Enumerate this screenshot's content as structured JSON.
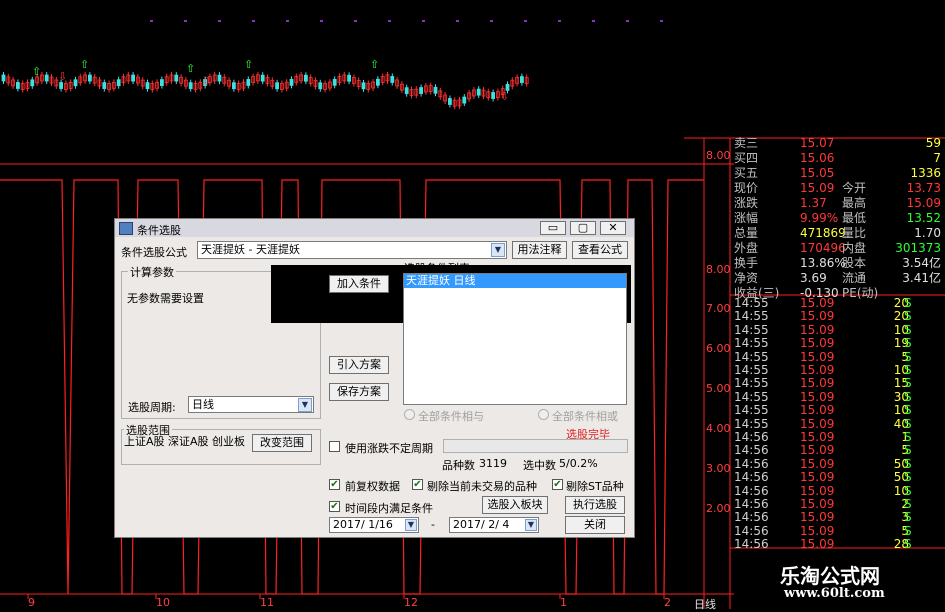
{
  "chart": {
    "price_labels": [
      "8.00",
      "8.00",
      "7.00",
      "6.00",
      "5.00",
      "4.00",
      "3.00",
      "2.00"
    ],
    "date_labels": [
      "9",
      "10",
      "11",
      "12",
      "1",
      "2"
    ],
    "period_label": "日线"
  },
  "colors": {
    "up": "#ff3030",
    "down": "#30ff30",
    "axis": "#ff2020",
    "dialog_bg": "#ece9e6",
    "selection": "#3399ff"
  },
  "quote_panel": {
    "rows": [
      {
        "label": "卖三",
        "value": "15.07",
        "extra": "",
        "value2": "59"
      },
      {
        "label": "买四",
        "value": "15.06",
        "extra": "",
        "value2": "7"
      },
      {
        "label": "买五",
        "value": "15.05",
        "extra": "",
        "value2": "1336"
      },
      {
        "label": "现价",
        "value": "15.09",
        "extra": "今开",
        "value2": "13.73"
      },
      {
        "label": "涨跌",
        "value": "1.37",
        "extra": "最高",
        "value2": "15.09"
      },
      {
        "label": "涨幅",
        "value": "9.99%",
        "extra": "最低",
        "value2": "13.52"
      },
      {
        "label": "总量",
        "value": "471869",
        "extra": "量比",
        "value2": "1.70"
      },
      {
        "label": "外盘",
        "value": "170496",
        "extra": "内盘",
        "value2": "301373"
      },
      {
        "label": "换手",
        "value": "13.86%",
        "extra": "股本",
        "value2": "3.54亿"
      },
      {
        "label": "净资",
        "value": "3.69",
        "extra": "流通",
        "value2": "3.41亿"
      },
      {
        "label": "收益(三)",
        "value": "-0.130",
        "extra": "PE(动)",
        "value2": ""
      }
    ],
    "ticks": [
      {
        "time": "14:55",
        "price": "15.09",
        "vol": "20",
        "side": "S"
      },
      {
        "time": "14:55",
        "price": "15.09",
        "vol": "20",
        "side": "S"
      },
      {
        "time": "14:55",
        "price": "15.09",
        "vol": "10",
        "side": "S"
      },
      {
        "time": "14:55",
        "price": "15.09",
        "vol": "19",
        "side": "S"
      },
      {
        "time": "14:55",
        "price": "15.09",
        "vol": "5",
        "side": "S"
      },
      {
        "time": "14:55",
        "price": "15.09",
        "vol": "10",
        "side": "S"
      },
      {
        "time": "14:55",
        "price": "15.09",
        "vol": "15",
        "side": "S"
      },
      {
        "time": "14:55",
        "price": "15.09",
        "vol": "30",
        "side": "S"
      },
      {
        "time": "14:55",
        "price": "15.09",
        "vol": "10",
        "side": "S"
      },
      {
        "time": "14:55",
        "price": "15.09",
        "vol": "40",
        "side": "S"
      },
      {
        "time": "14:56",
        "price": "15.09",
        "vol": "1",
        "side": "S"
      },
      {
        "time": "14:56",
        "price": "15.09",
        "vol": "5",
        "side": "S"
      },
      {
        "time": "14:56",
        "price": "15.09",
        "vol": "50",
        "side": "S"
      },
      {
        "time": "14:56",
        "price": "15.09",
        "vol": "50",
        "side": "S"
      },
      {
        "time": "14:56",
        "price": "15.09",
        "vol": "10",
        "side": "S"
      },
      {
        "time": "14:56",
        "price": "15.09",
        "vol": "2",
        "side": "S"
      },
      {
        "time": "14:56",
        "price": "15.09",
        "vol": "3",
        "side": "S"
      },
      {
        "time": "14:56",
        "price": "15.09",
        "vol": "5",
        "side": "S"
      },
      {
        "time": "14:56",
        "price": "15.09",
        "vol": "28",
        "side": "S"
      }
    ]
  },
  "dialog": {
    "title": "条件选股",
    "formula_label": "条件选股公式",
    "formula_value": "天涯提妖    - 天涯提妖",
    "usage_button": "用法注释",
    "view_formula_button": "查看公式",
    "params_group": "计算参数",
    "params_text": "无参数需要设置",
    "add_condition_button": "加入条件",
    "list_label": "选股条件列表",
    "list_items": [
      "天涯提妖   日线"
    ],
    "import_button": "引入方案",
    "save_button": "保存方案",
    "period_label": "选股周期:",
    "period_value": "日线",
    "radio_all_and": "全部条件相与",
    "radio_all_or": "全部条件相或",
    "status": "选股完毕",
    "range_group": "选股范围",
    "range_text": "上证A股 深证A股 创业板",
    "change_range_button": "改变范围",
    "use_unstable_label": "使用涨跌不定周期",
    "count_label": "品种数",
    "count_value": "3119",
    "selected_label": "选中数",
    "selected_value": "5/0.2%",
    "check_prior_rights": "前复权数据",
    "check_exclude_suspended": "剔除当前未交易的品种",
    "check_exclude_st": "剔除ST品种",
    "check_time_range": "时间段内满足条件",
    "to_block_button": "选股入板块",
    "run_button": "执行选股",
    "date_from": "2017/ 1/16",
    "date_to": "2017/ 2/ 4",
    "date_sep": "-",
    "close_button": "关闭"
  },
  "watermark": {
    "title": "乐淘公式网",
    "url": "www.60lt.com"
  }
}
